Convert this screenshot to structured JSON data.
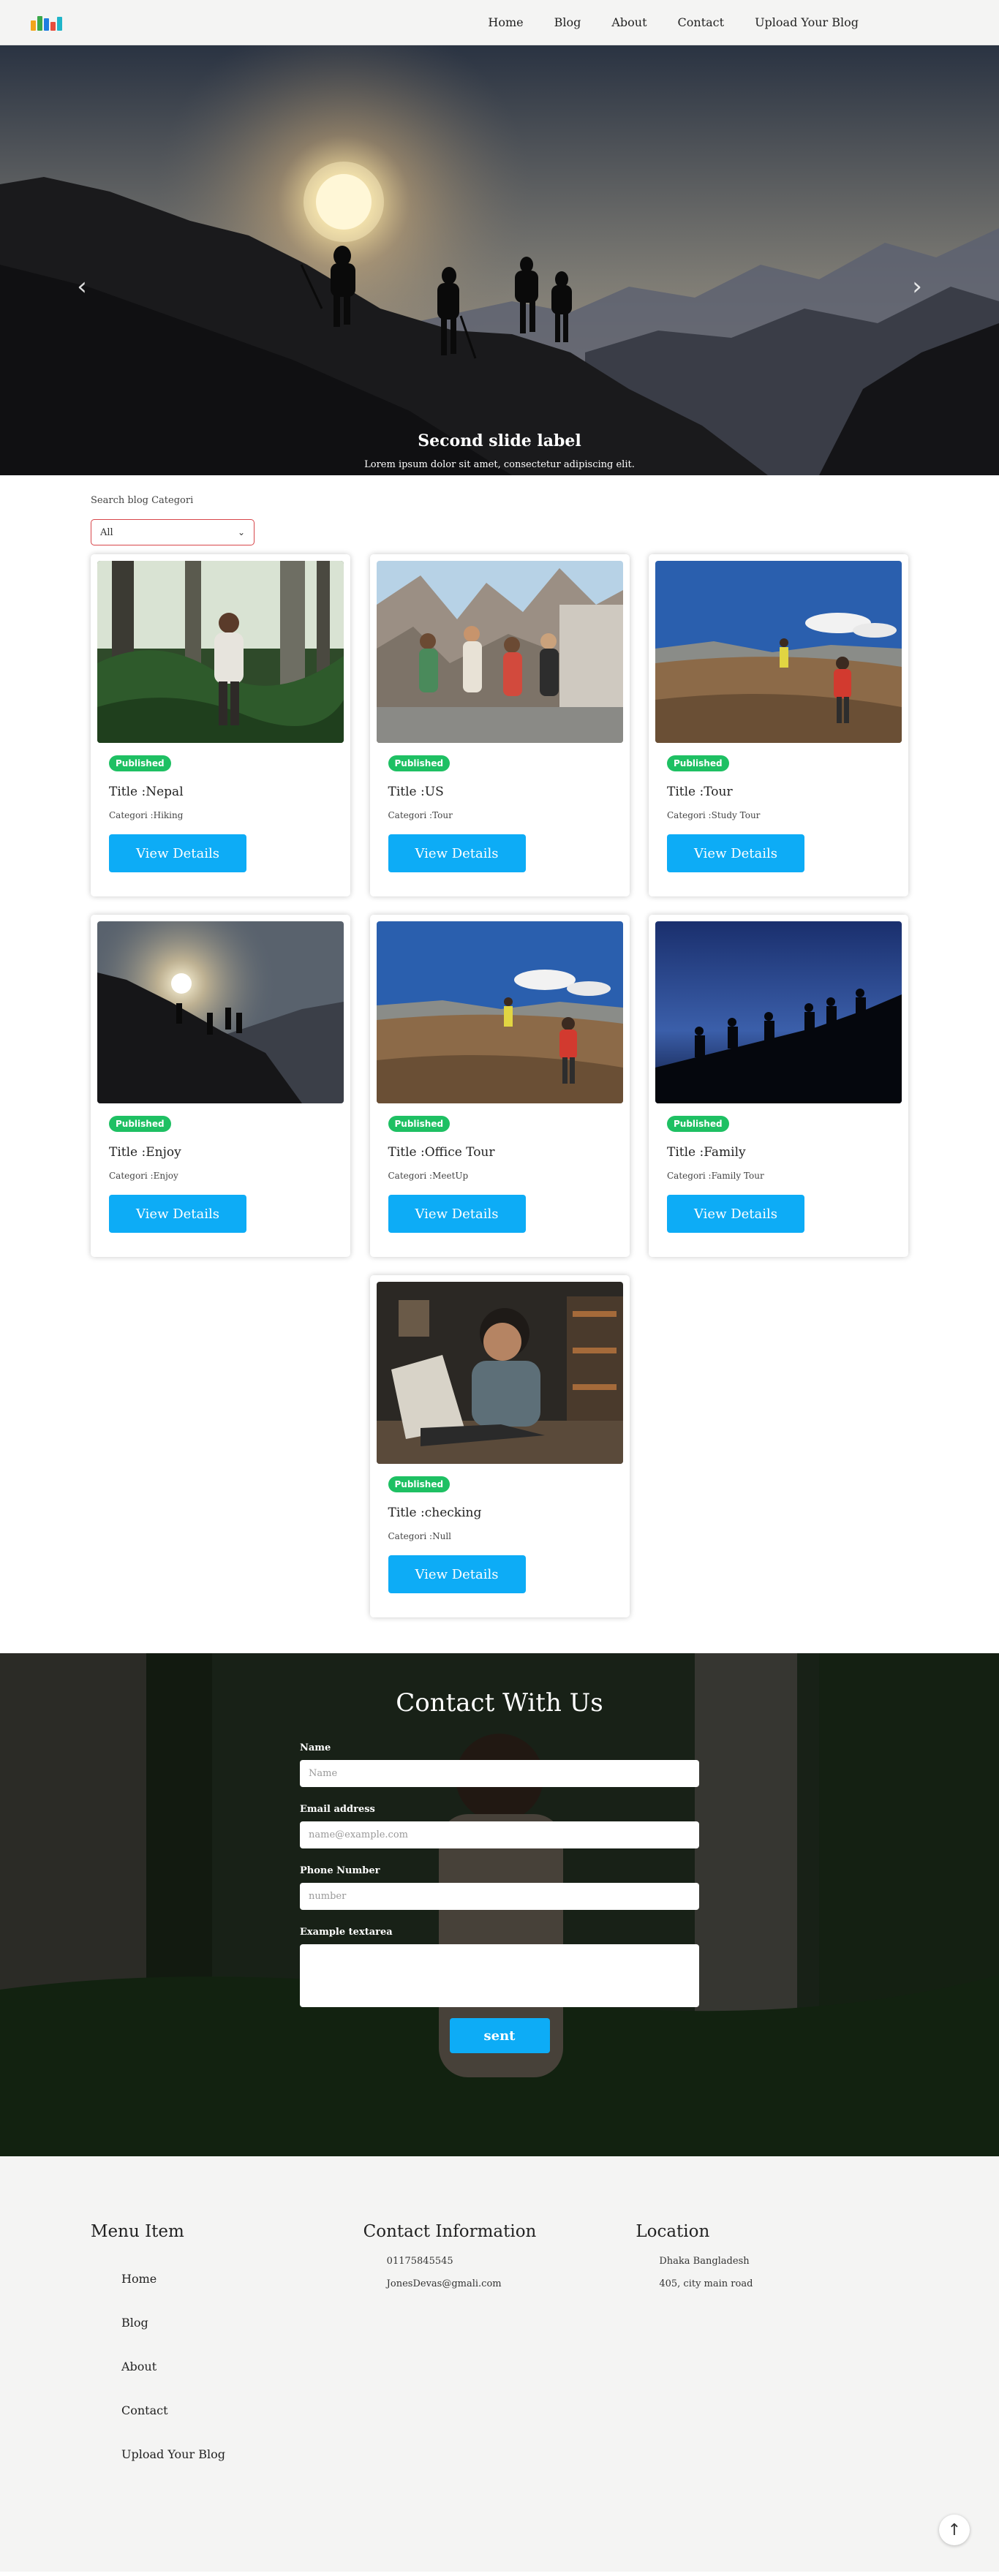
{
  "nav": {
    "logo_colors": [
      "#f2a41b",
      "#3aa84a",
      "#1f7ee0",
      "#e84d3d"
    ],
    "links": [
      "Home",
      "Blog",
      "About",
      "Contact",
      "Upload Your Blog"
    ]
  },
  "hero": {
    "caption_title": "Second slide label",
    "caption_text": "Lorem ipsum dolor sit amet, consectetur adipiscing elit.",
    "prev_icon": "chevron-left-icon",
    "next_icon": "chevron-right-icon",
    "slide_count": 3,
    "active_slide": 2
  },
  "filter": {
    "label": "Search blog Categori",
    "selected": "All"
  },
  "cards": [
    {
      "status": "Published",
      "title": "Title :Nepal",
      "category": "Categori :Hiking",
      "button": "View Details",
      "image": "forest-hiker-photo"
    },
    {
      "status": "Published",
      "title": "Title :US",
      "category": "Categori :Tour",
      "button": "View Details",
      "image": "mountain-group-photo"
    },
    {
      "status": "Published",
      "title": "Title :Tour",
      "category": "Categori :Study Tour",
      "button": "View Details",
      "image": "plateau-trekkers-photo"
    },
    {
      "status": "Published",
      "title": "Title :Enjoy",
      "category": "Categori :Enjoy",
      "button": "View Details",
      "image": "sunset-hikers-photo"
    },
    {
      "status": "Published",
      "title": "Title :Office Tour",
      "category": "Categori :MeetUp",
      "button": "View Details",
      "image": "plateau-trekkers-photo"
    },
    {
      "status": "Published",
      "title": "Title :Family",
      "category": "Categori :Family Tour",
      "button": "View Details",
      "image": "night-silhouettes-photo"
    },
    {
      "status": "Published",
      "title": "Title :checking",
      "category": "Categori :Null",
      "button": "View Details",
      "image": "boy-laptop-photo"
    }
  ],
  "contact": {
    "heading": "Contact With Us",
    "name_label": "Name",
    "name_placeholder": "Name",
    "email_label": "Email address",
    "email_placeholder": "name@example.com",
    "phone_label": "Phone Number",
    "phone_placeholder": "number",
    "textarea_label": "Example textarea",
    "submit": "sent"
  },
  "footer": {
    "menu_title": "Menu Item",
    "menu_items": [
      "Home",
      "Blog",
      "About",
      "Contact",
      "Upload Your Blog"
    ],
    "contact_title": "Contact Information",
    "phone": "01175845545",
    "email": "JonesDevas@gmali.com",
    "location_title": "Location",
    "city": "Dhaka Bangladesh",
    "address": "405, city main road",
    "to_top_icon": "arrow-up-icon"
  }
}
